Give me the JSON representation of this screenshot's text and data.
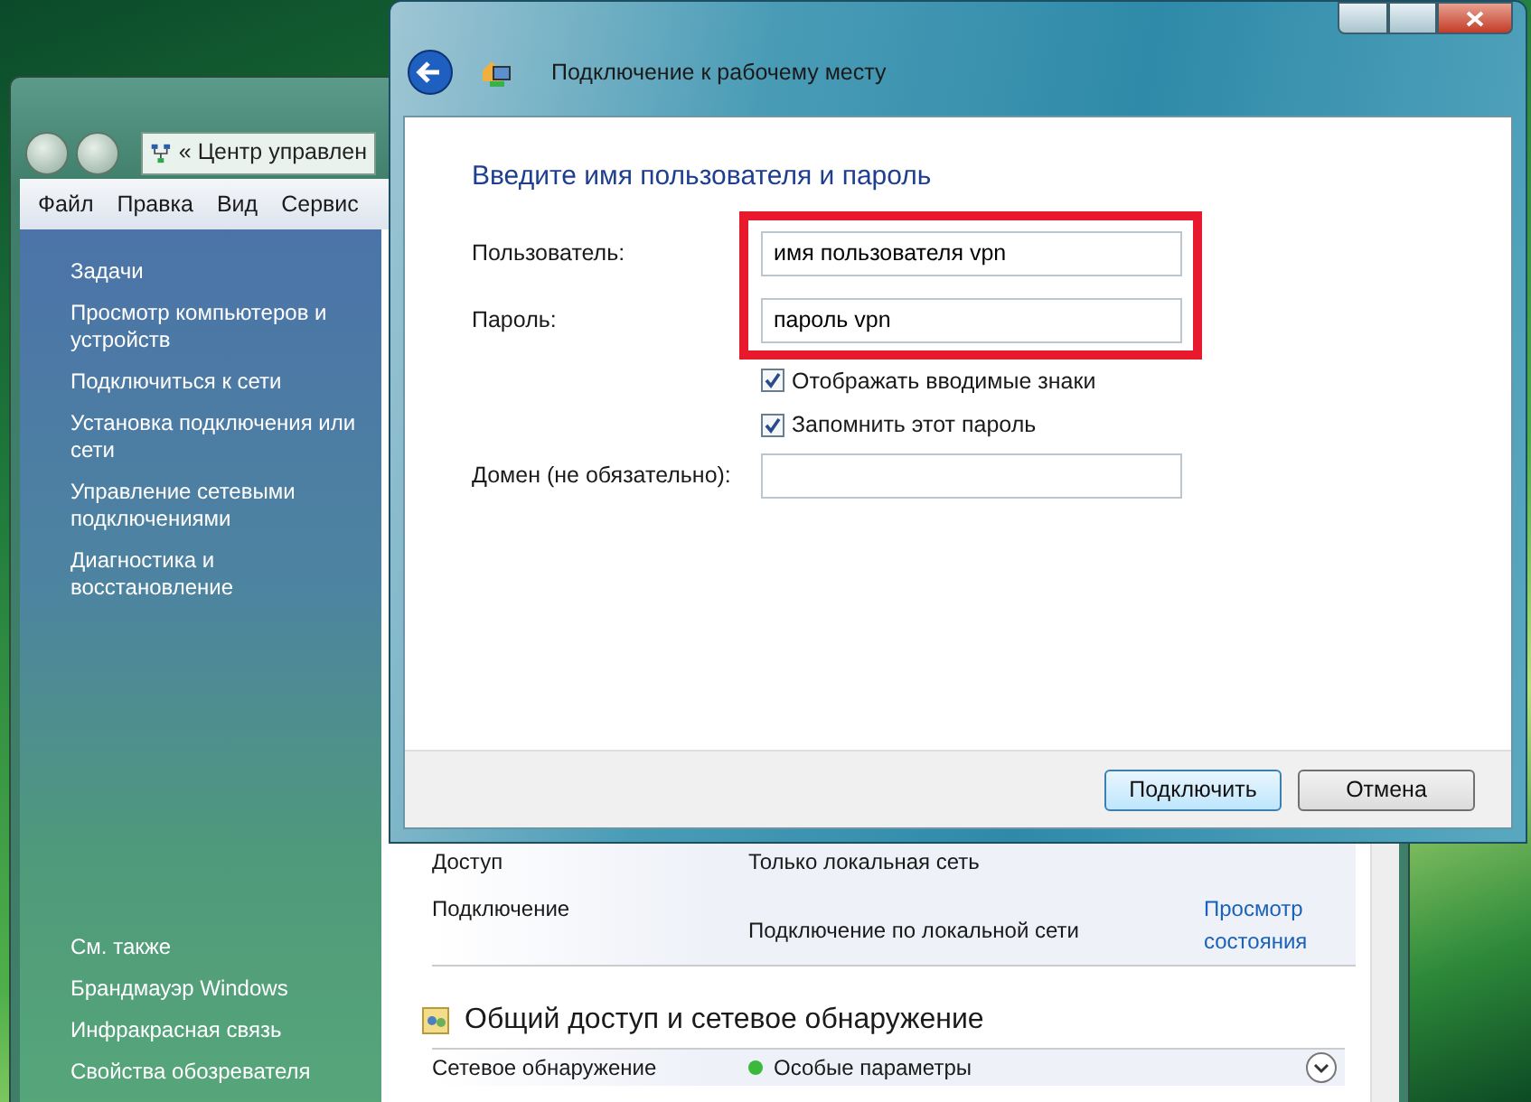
{
  "background_window": {
    "address_prefix": "«",
    "address": "Центр управлен",
    "menu": [
      "Файл",
      "Правка",
      "Вид",
      "Сервис"
    ],
    "tasks_heading": "Задачи",
    "tasks": [
      "Просмотр компьютеров и устройств",
      "Подключиться к сети",
      "Установка подключения или сети",
      "Управление сетевыми подключениями",
      "Диагностика и восстановление"
    ],
    "see_also_heading": "См. также",
    "see_also": [
      "Брандмауэр Windows",
      "Инфракрасная связь",
      "Свойства обозревателя"
    ],
    "details": [
      {
        "label": "Доступ",
        "value": "Только локальная сеть"
      },
      {
        "label": "Подключение",
        "value": "Подключение по локальной сети",
        "link": "Просмотр состояния"
      }
    ],
    "section": {
      "title": "Общий доступ и сетевое обнаружение",
      "rows": [
        {
          "label": "Сетевое обнаружение",
          "value": "Особые параметры",
          "color": "#3cb83c"
        }
      ]
    }
  },
  "dialog": {
    "title": "Подключение к рабочему месту",
    "heading": "Введите имя пользователя и пароль",
    "fields": [
      {
        "label": "Пользователь:",
        "value": "имя пользователя vpn"
      },
      {
        "label": "Пароль:",
        "value": "пароль vpn"
      }
    ],
    "checkboxes": [
      {
        "label": "Отображать вводимые знаки",
        "checked": true
      },
      {
        "label": "Запомнить этот пароль",
        "checked": true
      }
    ],
    "domain": {
      "label": "Домен (не обязательно):"
    },
    "buttons": [
      {
        "label": "Подключить",
        "default": true
      },
      {
        "label": "Отмена",
        "default": false
      }
    ]
  }
}
